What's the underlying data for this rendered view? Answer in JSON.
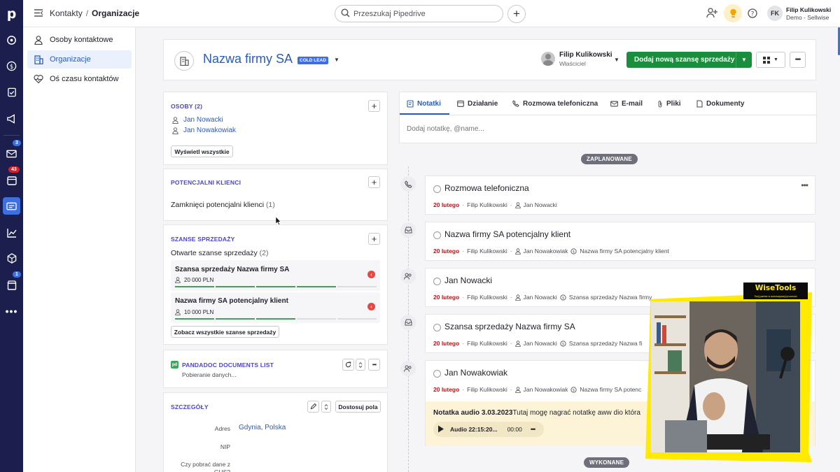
{
  "top": {
    "breadcrumb_root": "Kontakty",
    "breadcrumb_sep": "/",
    "breadcrumb_current": "Organizacje",
    "search_placeholder": "Przeszukaj Pipedrive",
    "user_initials": "FK",
    "user_name": "Filip Kulikowski",
    "user_company": "Demo - Sellwise"
  },
  "rail": {
    "badges": {
      "mail": "3",
      "calendar": "43",
      "marketplace": "1"
    }
  },
  "sidenav": {
    "items": [
      {
        "label": "Osoby kontaktowe"
      },
      {
        "label": "Organizacje"
      },
      {
        "label": "Oś czasu kontaktów"
      }
    ]
  },
  "org": {
    "name": "Nazwa firmy SA",
    "lead_badge": "COLD LEAD",
    "owner_name": "Filip Kulikowski",
    "owner_role": "Właściciel",
    "add_deal_label": "Dodaj nową szansę sprzedaży"
  },
  "people": {
    "title": "OSOBY (2)",
    "list": [
      "Jan Nowacki",
      "Jan Nowakowiak"
    ],
    "show_all": "Wyświetl wszystkie"
  },
  "leads": {
    "title": "POTENCJALNI KLIENCI",
    "closed_label": "Zamknięci potencjalni klienci",
    "closed_count": "(1)"
  },
  "deals": {
    "title": "SZANSE SPRZEDAŻY",
    "open_label": "Otwarte szanse sprzedaży",
    "open_count": "(2)",
    "items": [
      {
        "name": "Szansa sprzedaży Nazwa firmy SA",
        "value": "20 000 PLN",
        "progress": 0.8
      },
      {
        "name": "Nazwa firmy SA potencjalny klient",
        "value": "10 000 PLN",
        "progress": 0.6
      }
    ],
    "see_all": "Zobacz wszystkie szanse sprzedaży"
  },
  "pandadoc": {
    "title": "PANDADOC DOCUMENTS LIST",
    "loading": "Pobieranie danych..."
  },
  "details": {
    "title": "SZCZEGÓŁY",
    "customize": "Dostosuj pola",
    "fields": [
      {
        "label": "Adres",
        "value": "Gdynia, Polska"
      },
      {
        "label": "NIP",
        "value": ""
      },
      {
        "label": "Czy pobrać dane z GUS?",
        "value": ""
      }
    ]
  },
  "tabs": {
    "items": [
      "Notatki",
      "Działanie",
      "Rozmowa telefoniczna",
      "E-mail",
      "Pliki",
      "Dokumenty"
    ],
    "note_placeholder": "Dodaj notatkę, @name..."
  },
  "timeline": {
    "planned_label": "ZAPLANOWANE",
    "done_label": "WYKONANE",
    "activities": [
      {
        "title": "Rozmowa telefoniczna",
        "date": "20 lutego",
        "owner": "Filip Kulikowski",
        "person": "Jan Nowacki",
        "deal": ""
      },
      {
        "title": "Nazwa firmy SA potencjalny klient",
        "date": "20 lutego",
        "owner": "Filip Kulikowski",
        "person": "Jan Nowakowiak",
        "deal": "Nazwa firmy SA potencjalny klient"
      },
      {
        "title": "Jan Nowacki",
        "date": "20 lutego",
        "owner": "Filip Kulikowski",
        "person": "Jan Nowacki",
        "deal": "Szansa sprzedaży Nazwa firmy"
      },
      {
        "title": "Szansa sprzedaży Nazwa firmy SA",
        "date": "20 lutego",
        "owner": "Filip Kulikowski",
        "person": "Jan Nowacki",
        "deal": "Szansa sprzedaży Nazwa fi"
      },
      {
        "title": "Jan Nowakowiak",
        "date": "20 lutego",
        "owner": "Filip Kulikowski",
        "person": "Jan Nowakowiak",
        "deal": "Nazwa firmy SA potenc"
      }
    ],
    "audio_note_title": "Notatka audio 3.03.2023",
    "audio_note_text": "Tutaj mogę nagrać notatkę aww dio która",
    "audio_label": "Audio 22:15:20...",
    "audio_time": "00:00"
  },
  "overlay": {
    "brand": "WiseTools",
    "brand_tagline": "Twój partner w automatyzacji procesów"
  },
  "colors": {
    "accent": "#2a5cb9",
    "rail": "#1c1f4d",
    "green": "#1b8e3d",
    "section": "#4d46c8",
    "highlight": "#ffe600"
  }
}
